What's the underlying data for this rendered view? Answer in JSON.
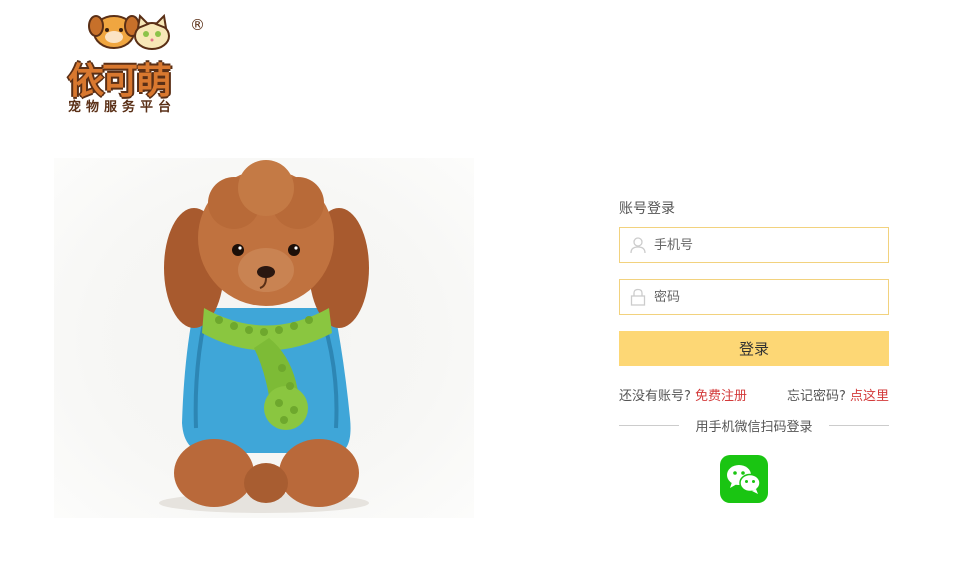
{
  "brand": {
    "name": "依可萌",
    "tagline": "宠物服务平台",
    "registered": "®",
    "colors": {
      "orange": "#d9782f",
      "brown": "#5a2f16"
    }
  },
  "hero": {
    "subject": "poodle-with-green-scarf-image"
  },
  "login": {
    "title": "账号登录",
    "phone": {
      "placeholder": "手机号",
      "value": ""
    },
    "password": {
      "placeholder": "密码",
      "value": ""
    },
    "submit_label": "登录",
    "no_account_text": "还没有账号?",
    "register_link": "免费注册",
    "forgot_text": "忘记密码?",
    "forgot_link": "点这里",
    "wechat_hint": "用手机微信扫码登录",
    "colors": {
      "field_border": "#f2d27e",
      "button": "#fdd775",
      "link": "#d33a3a",
      "wechat": "#1ac512"
    }
  }
}
